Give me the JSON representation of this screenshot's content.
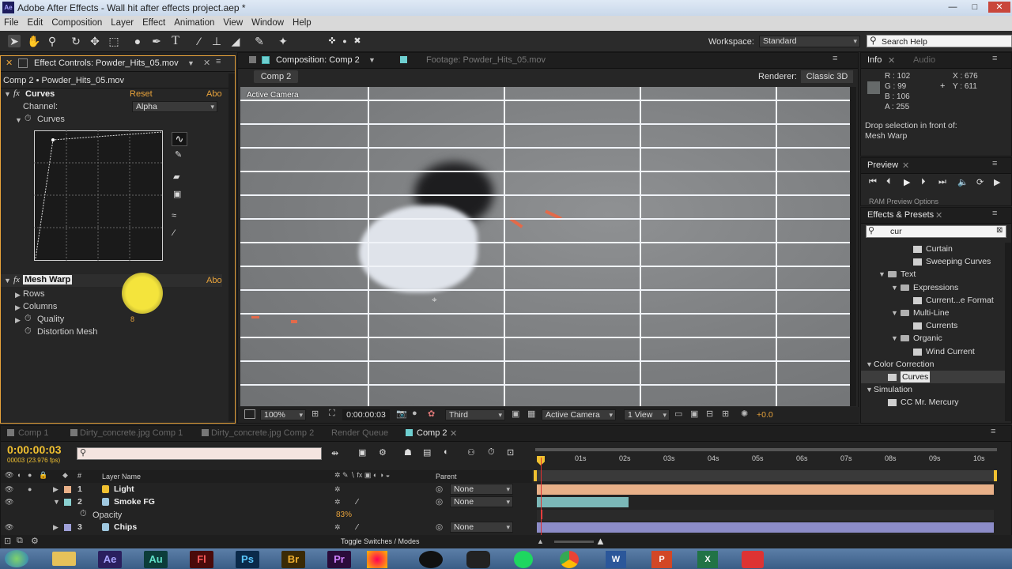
{
  "window": {
    "title": "Adobe After Effects - Wall hit after effects project.aep *",
    "app_icon": "Ae",
    "minimize": "—",
    "maximize": "□",
    "close": "✕"
  },
  "menu": [
    "File",
    "Edit",
    "Composition",
    "Layer",
    "Effect",
    "Animation",
    "View",
    "Window",
    "Help"
  ],
  "toolbar": {
    "workspace_label": "Workspace:",
    "workspace_value": "Standard",
    "search_placeholder": "Search Help"
  },
  "effect_controls": {
    "tab": "Effect Controls: Powder_Hits_05.mov",
    "subtitle": "Comp 2 • Powder_Hits_05.mov",
    "curves": {
      "name": "Curves",
      "reset": "Reset",
      "about": "Abo",
      "channel_label": "Channel:",
      "channel_value": "Alpha",
      "curves_label": "Curves"
    },
    "mesh_warp": {
      "name": "Mesh Warp",
      "about": "Abo",
      "props": [
        "Rows",
        "Columns",
        "Quality",
        "Distortion Mesh"
      ],
      "quality_value": "8"
    }
  },
  "composition": {
    "tab": "Composition: Comp 2",
    "footage_tab": "Footage: Powder_Hits_05.mov",
    "sub_tab": "Comp 2",
    "renderer_label": "Renderer:",
    "renderer_value": "Classic 3D",
    "viewer_label": "Active Camera",
    "footer": {
      "zoom": "100%",
      "timecode": "0:00:00:03",
      "resolution": "Third",
      "camera": "Active Camera",
      "views": "1 View",
      "exposure": "+0.0"
    }
  },
  "info": {
    "tab": "Info",
    "audio_tab": "Audio",
    "r": "R : 102",
    "g": "G : 99",
    "b": "B : 106",
    "a": "A : 255",
    "x": "X : 676",
    "y": "Y : 611",
    "message_line1": "Drop selection in front of:",
    "message_line2": "Mesh Warp"
  },
  "preview": {
    "tab": "Preview",
    "ram_options": "RAM Preview Options"
  },
  "effects_presets": {
    "tab": "Effects & Presets",
    "search_value": "cur",
    "items": [
      {
        "label": "Curtain",
        "kind": "fx",
        "level": 3
      },
      {
        "label": "Sweeping Curves",
        "kind": "fx",
        "level": 3
      },
      {
        "label": "Text",
        "kind": "folder",
        "level": 1,
        "open": true
      },
      {
        "label": "Expressions",
        "kind": "folder",
        "level": 2,
        "open": true
      },
      {
        "label": "Current...e Format",
        "kind": "fx",
        "level": 3
      },
      {
        "label": "Multi-Line",
        "kind": "folder",
        "level": 2,
        "open": true
      },
      {
        "label": "Currents",
        "kind": "fx",
        "level": 3
      },
      {
        "label": "Organic",
        "kind": "folder",
        "level": 2,
        "open": true
      },
      {
        "label": "Wind Current",
        "kind": "fx",
        "level": 3
      },
      {
        "label": "Color Correction",
        "kind": "group",
        "level": 0,
        "open": true
      },
      {
        "label": "Curves",
        "kind": "fx",
        "level": 1,
        "selected": true
      },
      {
        "label": "Simulation",
        "kind": "group",
        "level": 0,
        "open": true
      },
      {
        "label": "CC Mr. Mercury",
        "kind": "fx",
        "level": 1
      }
    ]
  },
  "timeline": {
    "tabs": [
      "Comp 1",
      "Dirty_concrete.jpg Comp 1",
      "Dirty_concrete.jpg Comp 2",
      "Render Queue",
      "Comp 2"
    ],
    "active_tab": "Comp 2",
    "timecode": "0:00:00:03",
    "frames": "00003 (23.976 fps)",
    "columns": {
      "num": "#",
      "layer_name": "Layer Name",
      "parent": "Parent"
    },
    "ruler": [
      "01s",
      "02s",
      "03s",
      "04s",
      "05s",
      "06s",
      "07s",
      "08s",
      "09s",
      "10s"
    ],
    "layers": [
      {
        "num": "1",
        "name": "Light",
        "parent": "None",
        "color": "#e8b088",
        "bar_color": "#e8b088",
        "bar_end": 1.0
      },
      {
        "num": "2",
        "name": "Smoke FG",
        "parent": "None",
        "color": "#8ad0d0",
        "bar_color": "#7bb8b8",
        "bar_end": 0.2
      },
      {
        "num": "3",
        "name": "Chips",
        "parent": "None",
        "color": "#9fa0d8",
        "bar_color": "#8c8cc8",
        "bar_end": 1.0
      }
    ],
    "opacity_label": "Opacity",
    "opacity_value": "83%",
    "toggle_label": "Toggle Switches / Modes"
  },
  "taskbar": {
    "apps": [
      {
        "label": "Ae",
        "bg": "#2a1f5e",
        "fg": "#a8a4ff"
      },
      {
        "label": "Au",
        "bg": "#0c3d3a",
        "fg": "#5fe0c8"
      },
      {
        "label": "Fl",
        "bg": "#4a0b0b",
        "fg": "#ff5a5a"
      },
      {
        "label": "Ps",
        "bg": "#0b2a4a",
        "fg": "#5ac8ff"
      },
      {
        "label": "Br",
        "bg": "#3a2a05",
        "fg": "#f0b030"
      },
      {
        "label": "Pr",
        "bg": "#2a0b3a",
        "fg": "#d080ff"
      }
    ]
  }
}
